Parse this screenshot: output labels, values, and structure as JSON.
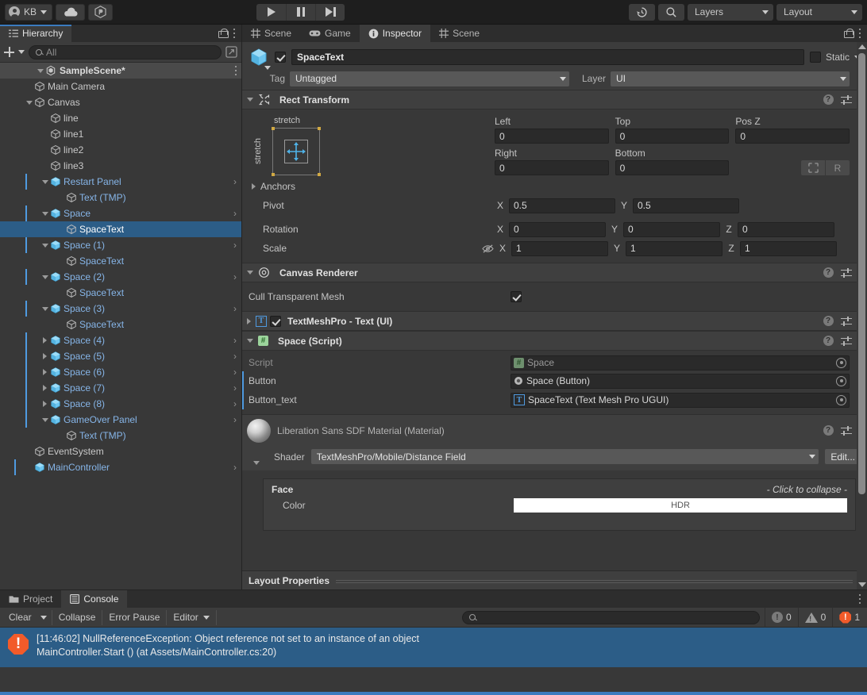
{
  "toolbar": {
    "account_label": "KB",
    "cloud_icon": "cloud-icon",
    "services_icon": "unity-services-icon",
    "play_icon": "play-icon",
    "pause_icon": "pause-icon",
    "step_icon": "step-icon",
    "history_icon": "history-icon",
    "search_icon": "search-icon",
    "layers_label": "Layers",
    "layout_label": "Layout"
  },
  "hierarchy": {
    "tab_label": "Hierarchy",
    "create_label": "+",
    "search_placeholder": "All",
    "scene_name": "SampleScene*",
    "items": [
      {
        "label": "Main Camera",
        "depth": 2,
        "arrow": "none",
        "icon": "gameobject",
        "prefab": false,
        "chevron": false,
        "selected": false
      },
      {
        "label": "Canvas",
        "depth": 2,
        "arrow": "down",
        "icon": "gameobject",
        "prefab": false,
        "chevron": false,
        "selected": false
      },
      {
        "label": "line",
        "depth": 3,
        "arrow": "none",
        "icon": "gameobject",
        "prefab": false,
        "chevron": false,
        "selected": false
      },
      {
        "label": "line1",
        "depth": 3,
        "arrow": "none",
        "icon": "gameobject",
        "prefab": false,
        "chevron": false,
        "selected": false
      },
      {
        "label": "line2",
        "depth": 3,
        "arrow": "none",
        "icon": "gameobject",
        "prefab": false,
        "chevron": false,
        "selected": false
      },
      {
        "label": "line3",
        "depth": 3,
        "arrow": "none",
        "icon": "gameobject",
        "prefab": false,
        "chevron": false,
        "selected": false
      },
      {
        "label": "Restart Panel",
        "depth": 3,
        "arrow": "down",
        "icon": "prefab",
        "prefab": true,
        "chevron": true,
        "selected": false
      },
      {
        "label": "Text (TMP)",
        "depth": 4,
        "arrow": "none",
        "icon": "prefab-child",
        "prefab": false,
        "chevron": false,
        "selected": false
      },
      {
        "label": "Space",
        "depth": 3,
        "arrow": "down",
        "icon": "prefab",
        "prefab": true,
        "chevron": true,
        "selected": false
      },
      {
        "label": "SpaceText",
        "depth": 4,
        "arrow": "none",
        "icon": "prefab-child",
        "prefab": false,
        "chevron": false,
        "selected": true
      },
      {
        "label": "Space (1)",
        "depth": 3,
        "arrow": "down",
        "icon": "prefab",
        "prefab": true,
        "chevron": true,
        "selected": false
      },
      {
        "label": "SpaceText",
        "depth": 4,
        "arrow": "none",
        "icon": "prefab-child",
        "prefab": false,
        "chevron": false,
        "selected": false
      },
      {
        "label": "Space (2)",
        "depth": 3,
        "arrow": "down",
        "icon": "prefab",
        "prefab": true,
        "chevron": true,
        "selected": false
      },
      {
        "label": "SpaceText",
        "depth": 4,
        "arrow": "none",
        "icon": "prefab-child",
        "prefab": false,
        "chevron": false,
        "selected": false
      },
      {
        "label": "Space (3)",
        "depth": 3,
        "arrow": "down",
        "icon": "prefab",
        "prefab": true,
        "chevron": true,
        "selected": false
      },
      {
        "label": "SpaceText",
        "depth": 4,
        "arrow": "none",
        "icon": "prefab-child",
        "prefab": false,
        "chevron": false,
        "selected": false
      },
      {
        "label": "Space (4)",
        "depth": 3,
        "arrow": "right",
        "icon": "prefab",
        "prefab": true,
        "chevron": true,
        "selected": false
      },
      {
        "label": "Space (5)",
        "depth": 3,
        "arrow": "right",
        "icon": "prefab",
        "prefab": true,
        "chevron": true,
        "selected": false
      },
      {
        "label": "Space (6)",
        "depth": 3,
        "arrow": "right",
        "icon": "prefab",
        "prefab": true,
        "chevron": true,
        "selected": false
      },
      {
        "label": "Space (7)",
        "depth": 3,
        "arrow": "right",
        "icon": "prefab",
        "prefab": true,
        "chevron": true,
        "selected": false
      },
      {
        "label": "Space (8)",
        "depth": 3,
        "arrow": "right",
        "icon": "prefab",
        "prefab": true,
        "chevron": true,
        "selected": false
      },
      {
        "label": "GameOver Panel",
        "depth": 3,
        "arrow": "down",
        "icon": "prefab",
        "prefab": true,
        "chevron": true,
        "selected": false
      },
      {
        "label": "Text (TMP)",
        "depth": 4,
        "arrow": "none",
        "icon": "prefab-child",
        "prefab": false,
        "chevron": false,
        "selected": false
      },
      {
        "label": "EventSystem",
        "depth": 2,
        "arrow": "none",
        "icon": "gameobject",
        "prefab": false,
        "chevron": false,
        "selected": false
      },
      {
        "label": "MainController",
        "depth": 2,
        "arrow": "none",
        "icon": "prefab",
        "prefab": true,
        "chevron": true,
        "selected": false
      }
    ]
  },
  "inspector": {
    "tabs": [
      {
        "label": "Scene",
        "icon": "grid-icon",
        "active": false
      },
      {
        "label": "Game",
        "icon": "gamepad-icon",
        "active": false
      },
      {
        "label": "Inspector",
        "icon": "info-icon",
        "active": true
      },
      {
        "label": "Scene",
        "icon": "grid-icon",
        "active": false
      }
    ],
    "object": {
      "name": "SpaceText",
      "enabled": true,
      "static_label": "Static",
      "tag_label": "Tag",
      "tag_value": "Untagged",
      "layer_label": "Layer",
      "layer_value": "UI"
    },
    "rect_transform": {
      "title": "Rect Transform",
      "anchor_preset_h": "stretch",
      "anchor_preset_v": "stretch",
      "left_label": "Left",
      "left_value": "0",
      "top_label": "Top",
      "top_value": "0",
      "posz_label": "Pos Z",
      "posz_value": "0",
      "right_label": "Right",
      "right_value": "0",
      "bottom_label": "Bottom",
      "bottom_value": "0",
      "blueprint_btn": "blueprint-mode-icon",
      "raw_btn": "R",
      "anchors_label": "Anchors",
      "pivot_label": "Pivot",
      "pivot_x": "0.5",
      "pivot_y": "0.5",
      "rotation_label": "Rotation",
      "rot_x": "0",
      "rot_y": "0",
      "rot_z": "0",
      "scale_label": "Scale",
      "scale_x": "1",
      "scale_y": "1",
      "scale_z": "1"
    },
    "canvas_renderer": {
      "title": "Canvas Renderer",
      "cull_label": "Cull Transparent Mesh",
      "cull_checked": true
    },
    "tmp_text": {
      "title": "TextMeshPro - Text (UI)",
      "enabled": true
    },
    "space_script": {
      "title": "Space (Script)",
      "script_label": "Script",
      "script_value": "Space",
      "button_label": "Button",
      "button_value": "Space (Button)",
      "button_text_label": "Button_text",
      "button_text_value": "SpaceText (Text Mesh Pro UGUI)"
    },
    "material": {
      "title": "Liberation Sans SDF Material (Material)",
      "shader_label": "Shader",
      "shader_value": "TextMeshPro/Mobile/Distance Field",
      "edit_label": "Edit..."
    },
    "face": {
      "title": "Face",
      "collapse_hint": "- Click to collapse -",
      "color_label": "Color",
      "color_hdr": "HDR",
      "color_value": "#ffffff"
    },
    "layout_properties": {
      "title": "Layout Properties"
    }
  },
  "console": {
    "tabs": [
      {
        "label": "Project",
        "icon": "folder-icon",
        "active": false
      },
      {
        "label": "Console",
        "icon": "console-icon",
        "active": true
      }
    ],
    "clear_label": "Clear",
    "collapse_label": "Collapse",
    "error_pause_label": "Error Pause",
    "editor_label": "Editor",
    "search_placeholder": "",
    "counts": {
      "info": "0",
      "warning": "0",
      "error": "1"
    },
    "entry": {
      "line1": "[11:46:02] NullReferenceException: Object reference not set to an instance of an object",
      "line2": "MainController.Start () (at Assets/MainController.cs:20)"
    }
  },
  "colors": {
    "accent_blue": "#3b7bbf",
    "selection_blue": "#2c5d87",
    "prefab_blue": "#4f9ae0",
    "error_orange": "#f25b2a",
    "panel_bg": "#383838",
    "header_bg": "#3f3f3f"
  }
}
